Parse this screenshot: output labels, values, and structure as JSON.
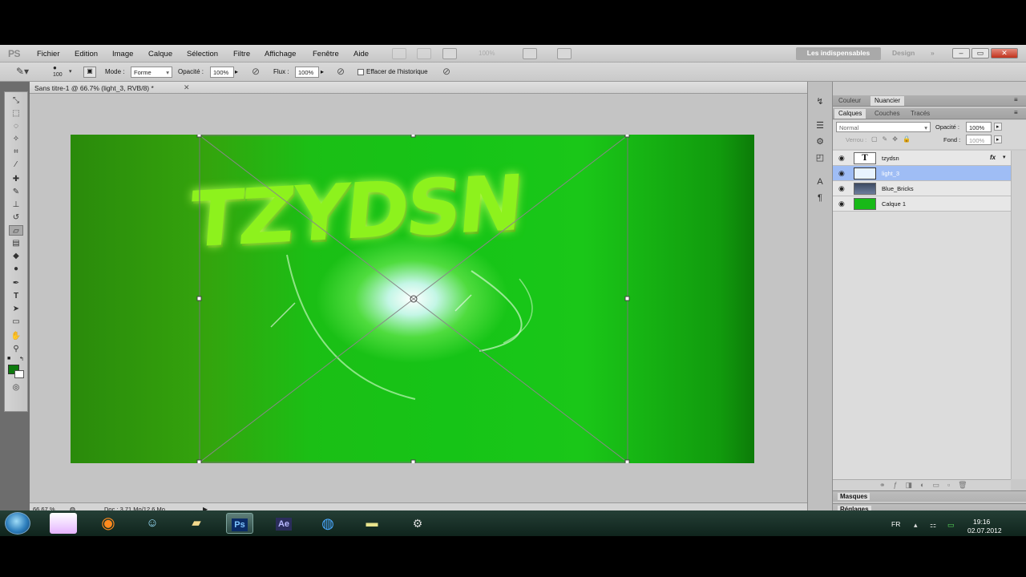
{
  "app": {
    "logo": "PS"
  },
  "menu": [
    "Fichier",
    "Edition",
    "Image",
    "Calque",
    "Sélection",
    "Filtre",
    "Affichage",
    "Fenêtre",
    "Aide"
  ],
  "toolbar": {
    "zoom_display": "100%"
  },
  "workspaces": {
    "active": "Les indispensables",
    "other": "Design",
    "more": "»"
  },
  "options": {
    "brush_size": "100",
    "mode_label": "Mode :",
    "mode_value": "Forme",
    "opacity_label": "Opacité :",
    "opacity_value": "100%",
    "flow_label": "Flux :",
    "flow_value": "100%",
    "history_label": "Effacer de l'historique"
  },
  "document": {
    "tab_title": "Sans titre-1 @ 66.7% (light_3, RVB/8) *",
    "close": "✕",
    "artwork_text": "TZYDSN",
    "zoom": "66.67 %",
    "doc_info": "Doc : 3.71 Mo/12.6 Mo"
  },
  "panels": {
    "top_tabs": [
      "Couleur",
      "Nuancier"
    ],
    "layer_tabs": [
      "Calques",
      "Couches",
      "Tracés"
    ],
    "blend_mode": "Normal",
    "opacity_label": "Opacité :",
    "opacity_value": "100%",
    "lock_label": "Verrou :",
    "fill_label": "Fond :",
    "fill_value": "100%",
    "layers": [
      {
        "name": "tzydsn",
        "thumb": "T",
        "fx": "fx",
        "selected": false
      },
      {
        "name": "light_3",
        "thumb": "",
        "selected": true
      },
      {
        "name": "Blue_Bricks",
        "thumb": "",
        "selected": false
      },
      {
        "name": "Calque 1",
        "thumb": "",
        "selected": false
      }
    ],
    "collapsed": [
      "Masques",
      "Réglages"
    ]
  },
  "taskbar": {
    "lang": "FR",
    "time": "19:16",
    "date": "02.07.2012",
    "ps_label": "Ps",
    "ae_label": "Ae"
  },
  "colors": {
    "foreground": "#0d7a0d",
    "artwork_green": "#16c417",
    "selection": "#9fbdf5"
  }
}
